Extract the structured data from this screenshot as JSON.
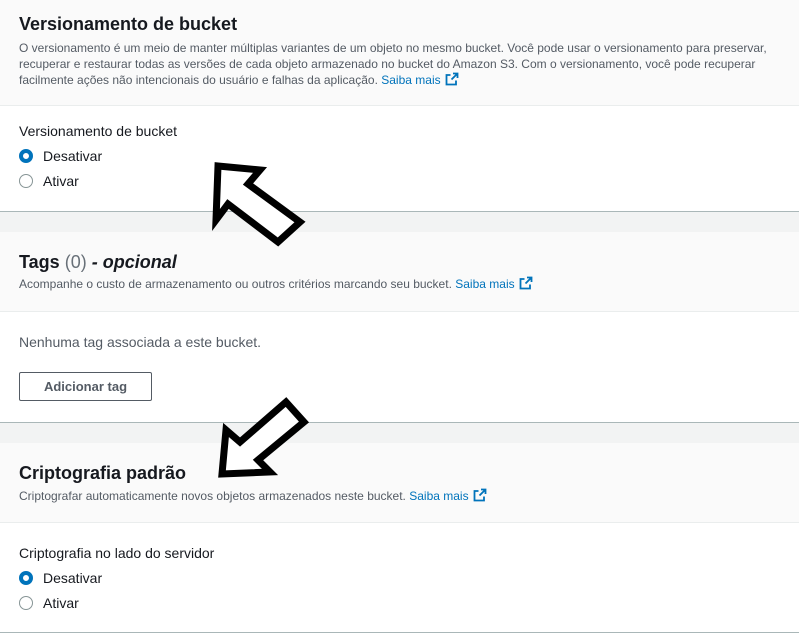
{
  "versioning": {
    "title": "Versionamento de bucket",
    "description": "O versionamento é um meio de manter múltiplas variantes de um objeto no mesmo bucket. Você pode usar o versionamento para preservar, recuperar e restaurar todas as versões de cada objeto armazenado no bucket do Amazon S3. Com o versionamento, você pode recuperar facilmente ações não intencionais do usuário e falhas da aplicação.",
    "learn_more": "Saiba mais",
    "field_label": "Versionamento de bucket",
    "options": [
      {
        "label": "Desativar",
        "checked": true
      },
      {
        "label": "Ativar",
        "checked": false
      }
    ]
  },
  "tags": {
    "title": "Tags",
    "count": "(0)",
    "optional": "- opcional",
    "description": "Acompanhe o custo de armazenamento ou outros critérios marcando seu bucket.",
    "learn_more": "Saiba mais",
    "empty_text": "Nenhuma tag associada a este bucket.",
    "add_button": "Adicionar tag"
  },
  "encryption": {
    "title": "Criptografia padrão",
    "description": "Criptografar automaticamente novos objetos armazenados neste bucket.",
    "learn_more": "Saiba mais",
    "field_label": "Criptografia no lado do servidor",
    "options": [
      {
        "label": "Desativar",
        "checked": true
      },
      {
        "label": "Ativar",
        "checked": false
      }
    ]
  },
  "colors": {
    "link": "#0073bb",
    "radio_selected": "#0073bb",
    "header_bg": "#fafafa",
    "divider": "#aab7b8"
  },
  "icons": [
    "external-link-icon",
    "arrow-up-left-icon",
    "arrow-down-left-icon"
  ]
}
